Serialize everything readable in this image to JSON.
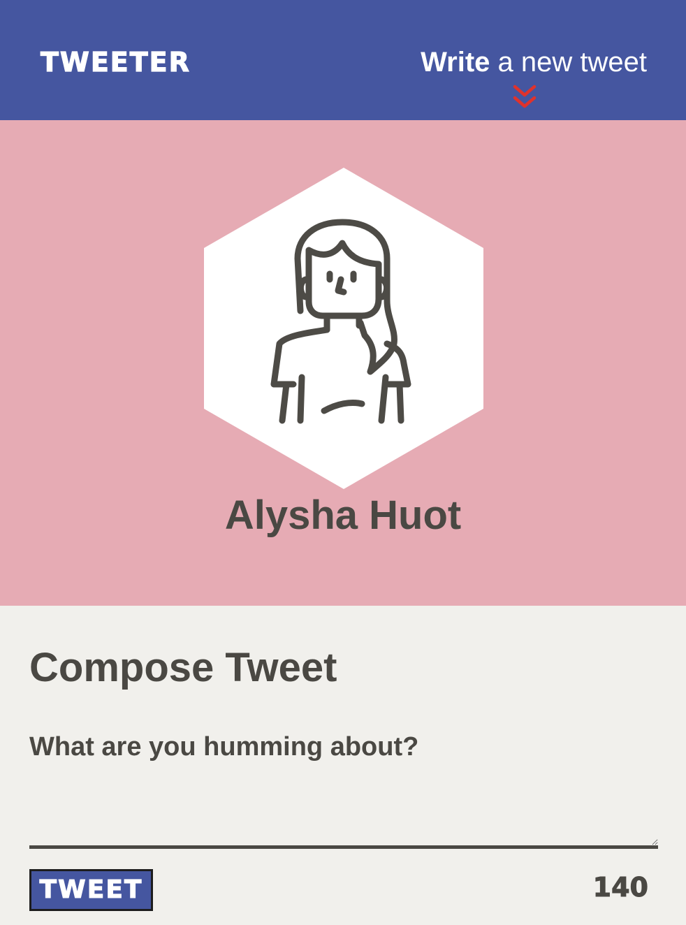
{
  "nav": {
    "brand": "TWEETER",
    "compose_toggle": {
      "bold": "Write",
      "rest": " a new tweet",
      "icon": "double-chevron-down-icon"
    }
  },
  "profile": {
    "avatar_icon": "woman-avatar-icon",
    "name": "Alysha Huot"
  },
  "compose": {
    "title": "Compose Tweet",
    "placeholder": "What are you humming about?",
    "value": "",
    "button_label": "TWEET",
    "counter": "140"
  },
  "colors": {
    "nav_bg": "#4556a0",
    "profile_bg": "#e6abb4",
    "compose_bg": "#f1f0ec",
    "text": "#4a4843",
    "chevron": "#e0322c"
  }
}
